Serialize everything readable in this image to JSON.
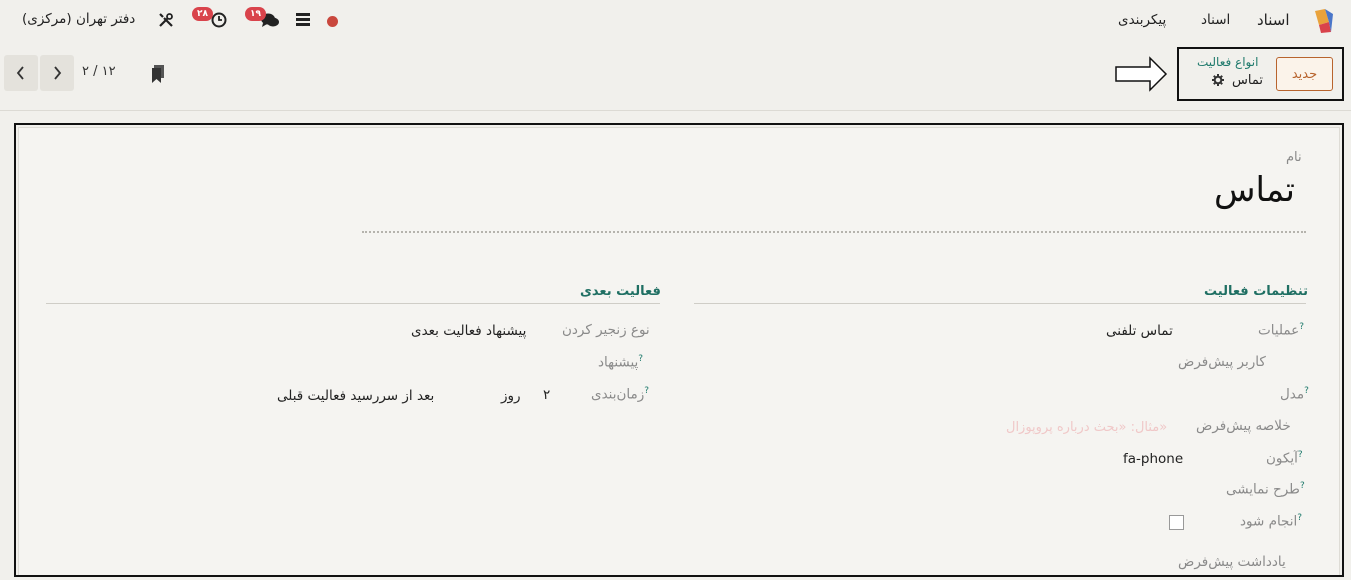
{
  "topbar": {
    "app_name": "اسناد",
    "menu": [
      "اسناد",
      "پیکربندی"
    ],
    "company": "دفتر تهران (مرکزی)",
    "activity_count": "۲۸",
    "messages_count": "۱۹"
  },
  "control_panel": {
    "new_button": "جدید",
    "breadcrumb_parent": "انواع فعالیت",
    "breadcrumb_current": "تماس",
    "pager": "۲ / ۱۲"
  },
  "form": {
    "name_label": "نام",
    "name_value": "تماس",
    "activity_settings": {
      "title": "تنظیمات فعالیت",
      "operations_label": "عملیات",
      "operations_value": "تماس تلفنی",
      "default_user_label": "کاربر پیش‌فرض",
      "model_label": "مدل",
      "default_summary_label": "خلاصه پیش‌فرض",
      "default_summary_placeholder": "مثال: «بحث درباره پروپوزال»",
      "icon_label": "آیکون",
      "icon_value": "fa-phone",
      "decoration_label": "طرح نمایشی",
      "done_label": "انجام شود",
      "default_note_label": "یادداشت پیش‌فرض"
    },
    "next_activity": {
      "title": "فعالیت بعدی",
      "chaining_label": "نوع زنجیر کردن",
      "chaining_value": "پیشنهاد فعالیت بعدی",
      "suggest_label": "پیشنهاد",
      "schedule_label": "زمان‌بندی",
      "schedule_amount": "۲",
      "schedule_unit": "روز",
      "schedule_after": "بعد از سررسید فعالیت قبلی"
    }
  },
  "colors": {
    "accent": "#1f7a6c",
    "primary_btn": "#b8642e",
    "badge": "#d9434b"
  }
}
